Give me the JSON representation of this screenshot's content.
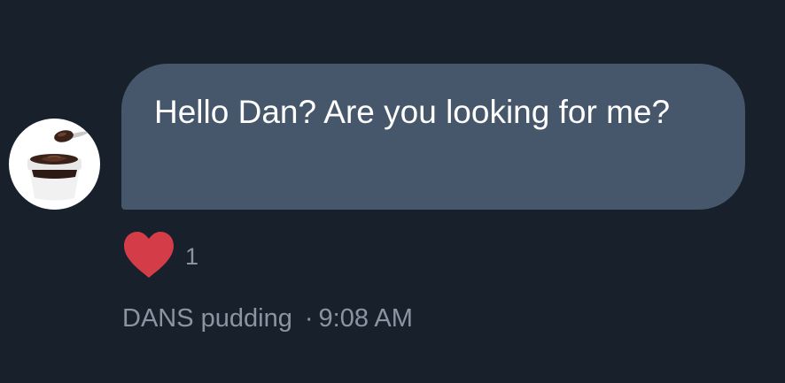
{
  "message": {
    "text": "Hello Dan? Are you looking for me?",
    "bubble_color": "#46576b"
  },
  "sender": {
    "name": "DANS pudding",
    "avatar_icon": "pudding-cup-icon"
  },
  "timestamp": {
    "separator": "·",
    "time": "9:08 AM"
  },
  "reaction": {
    "icon": "heart-icon",
    "count": "1",
    "color": "#d43c47"
  },
  "colors": {
    "background": "#18202c",
    "meta_text": "#8b95a2"
  }
}
